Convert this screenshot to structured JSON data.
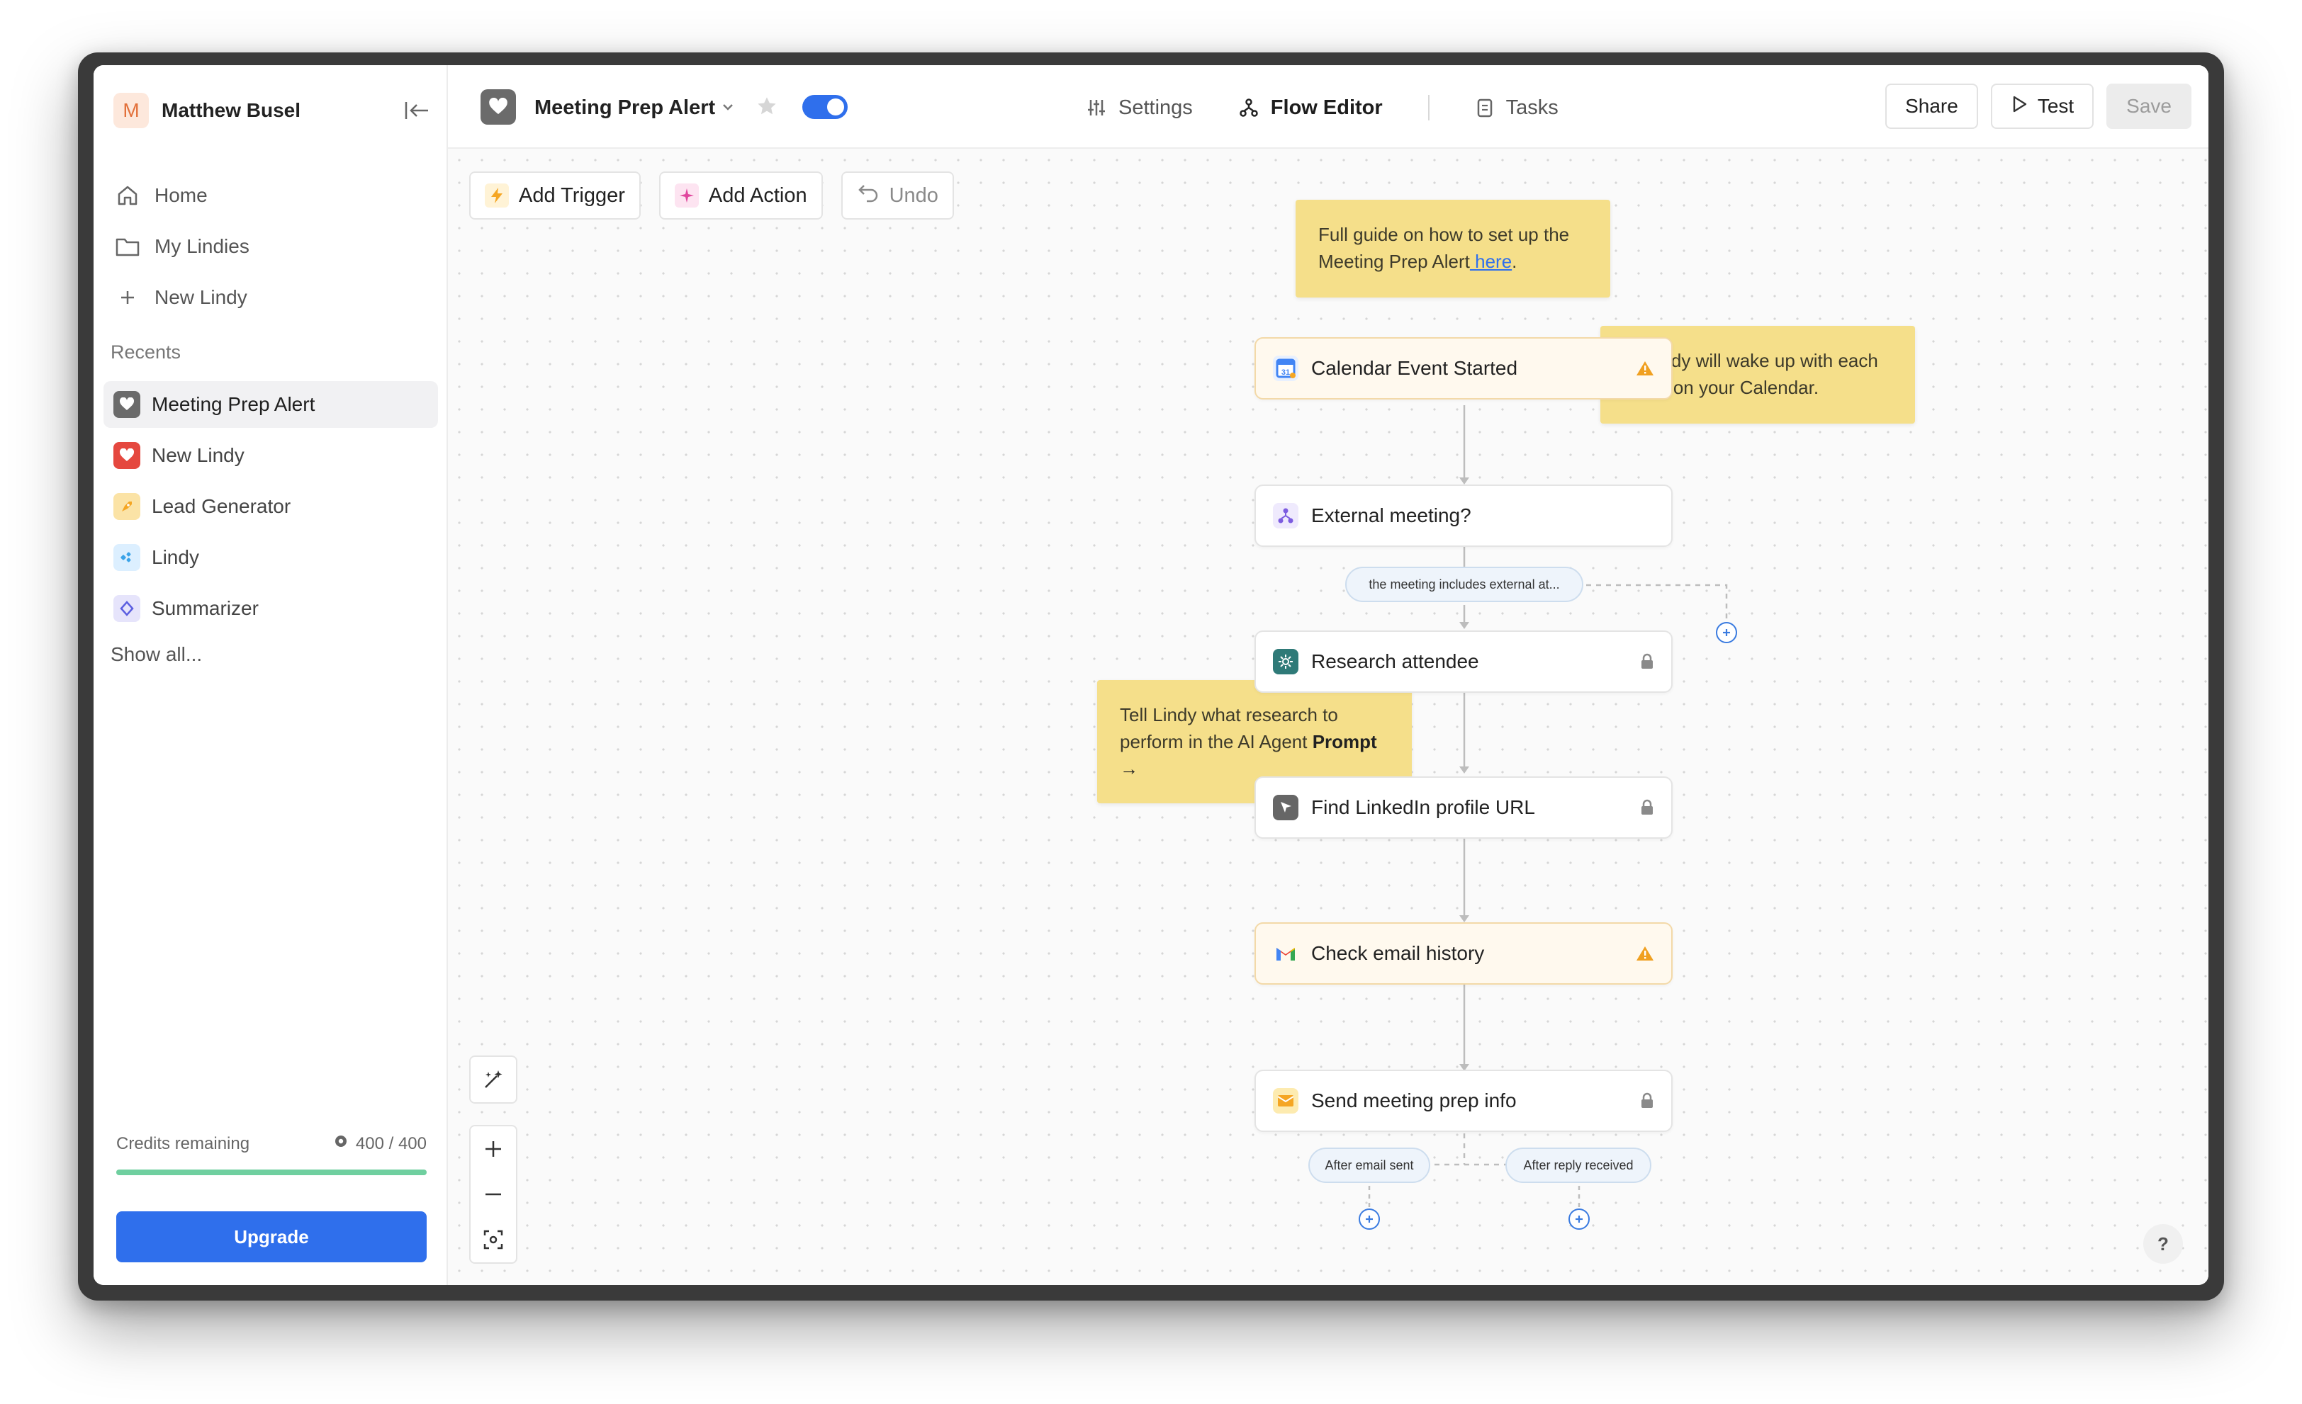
{
  "sidebar": {
    "user": {
      "initial": "M",
      "name": "Matthew Busel"
    },
    "nav": [
      {
        "label": "Home",
        "icon": "home-icon"
      },
      {
        "label": "My Lindies",
        "icon": "folder-icon"
      },
      {
        "label": "New Lindy",
        "icon": "plus-icon"
      }
    ],
    "recents_label": "Recents",
    "recents": [
      {
        "label": "Meeting Prep Alert",
        "icon": "heart-icon",
        "color": "#6b6b6b",
        "active": true
      },
      {
        "label": "New Lindy",
        "icon": "heart-icon",
        "color": "#e5483f"
      },
      {
        "label": "Lead Generator",
        "icon": "rocket-icon",
        "color": "#f5b13a"
      },
      {
        "label": "Lindy",
        "icon": "sparkle-icon",
        "color": "#3aa3e8"
      },
      {
        "label": "Summarizer",
        "icon": "diamond-icon",
        "color": "#5b5ee0"
      }
    ],
    "show_all": "Show all...",
    "credits": {
      "label": "Credits remaining",
      "value": "400 / 400",
      "fraction": 1.0
    },
    "upgrade_label": "Upgrade"
  },
  "topbar": {
    "flow_title": "Meeting Prep Alert",
    "enabled": true,
    "tabs": [
      {
        "label": "Settings",
        "icon": "sliders-icon"
      },
      {
        "label": "Flow Editor",
        "icon": "flow-icon",
        "active": true
      },
      {
        "label": "Tasks",
        "icon": "clipboard-icon"
      }
    ],
    "share_label": "Share",
    "test_label": "Test",
    "save_label": "Save"
  },
  "canvas": {
    "toolbar": {
      "add_trigger": "Add Trigger",
      "add_action": "Add Action",
      "undo": "Undo"
    },
    "notes": {
      "guide_pre": "Full guide on how to set up the Meeting Prep Alert",
      "guide_link": " here",
      "guide_post": ".",
      "wake": "← Lindy will wake up with each event on your Calendar.",
      "research_pre": "Tell Lindy what research to perform in the AI Agent ",
      "research_bold": "Prompt →"
    },
    "nodes": [
      {
        "label": "Calendar Event Started",
        "status": "warning"
      },
      {
        "label": "External meeting?",
        "status": ""
      },
      {
        "label": "Research attendee",
        "status": "locked"
      },
      {
        "label": "Find LinkedIn profile URL",
        "status": "locked"
      },
      {
        "label": "Check email history",
        "status": "warning"
      },
      {
        "label": "Send meeting prep info",
        "status": "locked"
      }
    ],
    "branches": {
      "condition": "the meeting includes external at...",
      "after_sent": "After email sent",
      "after_reply": "After reply received"
    },
    "help": "?"
  },
  "colors": {
    "accent": "#2f6fec",
    "note": "#f5df8a",
    "warning": "#f0a020"
  }
}
